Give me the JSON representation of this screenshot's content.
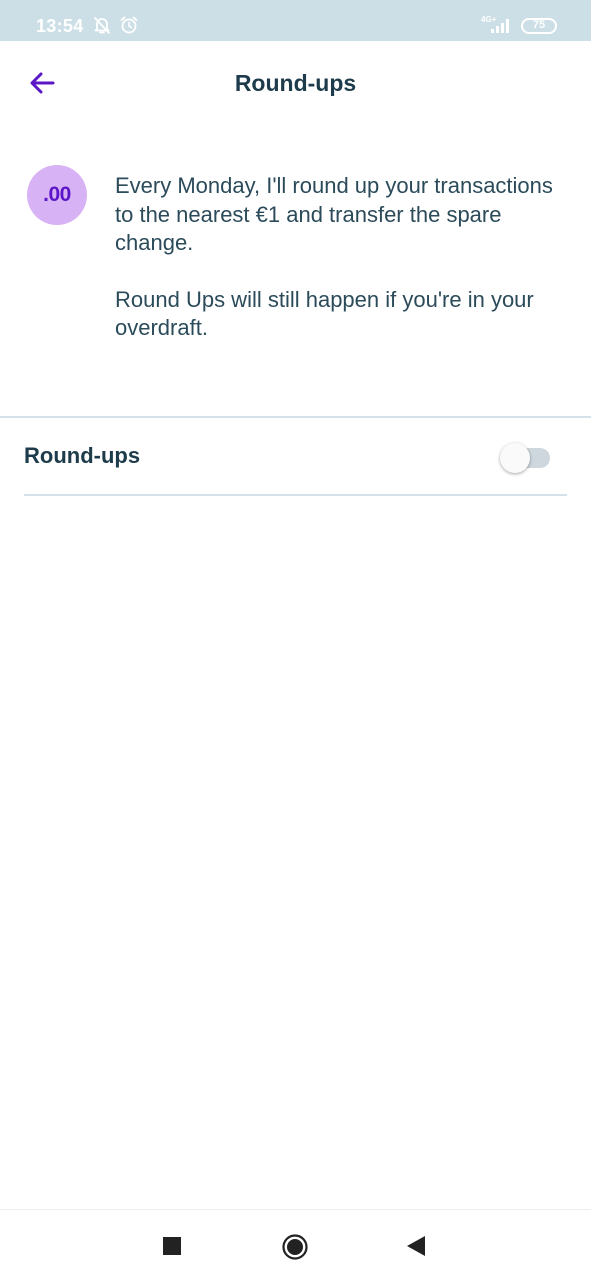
{
  "status_bar": {
    "time": "13:54",
    "network_label": "4G+",
    "battery": "75",
    "background_color": "#cddfe6"
  },
  "header": {
    "title": "Round-ups",
    "back_icon": "arrow-left-icon",
    "accent_color": "#5b16c8"
  },
  "info": {
    "badge_text": ".00",
    "badge_color": "#d7b2f5",
    "paragraph_1": "Every Monday, I'll round up your transactions to the nearest €1 and transfer the spare change.",
    "paragraph_2": "Round Ups will still happen if you're in your overdraft."
  },
  "setting": {
    "label": "Round-ups",
    "enabled": false
  },
  "nav_bar": {
    "recents_icon": "square-icon",
    "home_icon": "circle-icon",
    "back_icon": "triangle-back-icon"
  }
}
